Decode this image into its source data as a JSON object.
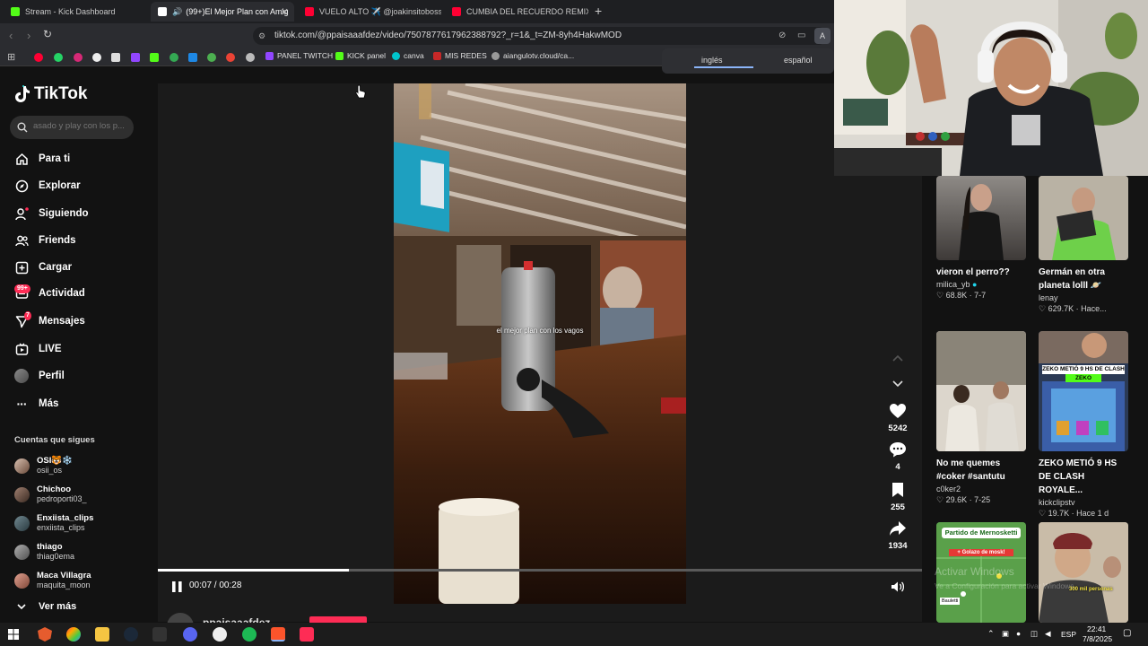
{
  "browser": {
    "tabs": [
      {
        "title": "Stream - Kick Dashboard",
        "color": "#53fc18"
      },
      {
        "title": "(99+)El Mejor Plan con Amig",
        "color": "#ffffff"
      },
      {
        "title": "VUELO ALTO ✈️ @joakinsitoboss - Y",
        "color": "#ff0033"
      },
      {
        "title": "CUMBIA DEL RECUERDO REMIXADA",
        "color": "#ff0033"
      }
    ],
    "new_tab": "+",
    "url": "tiktok.com/@ppaisaaafdez/video/7507877617962388792?_r=1&_t=ZM-8yh4HakwMOD",
    "bookmarks": [
      "PANEL TWITCH",
      "KICK panel",
      "canva",
      "MIS REDES",
      "aiangulotv.cloud/ca..."
    ],
    "translate": {
      "left": "inglés",
      "right": "español"
    }
  },
  "sidebar": {
    "logo": "TikTok",
    "search_placeholder": "asado y play con los p...",
    "nav": [
      {
        "label": "Para ti",
        "icon": "home-icon"
      },
      {
        "label": "Explorar",
        "icon": "compass-icon"
      },
      {
        "label": "Siguiendo",
        "icon": "following-icon"
      },
      {
        "label": "Friends",
        "icon": "friends-icon"
      },
      {
        "label": "Cargar",
        "icon": "upload-icon"
      },
      {
        "label": "Actividad",
        "icon": "activity-icon",
        "badge": "99+"
      },
      {
        "label": "Mensajes",
        "icon": "messages-icon",
        "badge": "7"
      },
      {
        "label": "LIVE",
        "icon": "live-icon"
      },
      {
        "label": "Perfil",
        "icon": "profile-icon"
      },
      {
        "label": "Más",
        "icon": "more-icon"
      }
    ],
    "following_title": "Cuentas que sigues",
    "accounts": [
      {
        "name": "OSI🐯❄️",
        "handle": "osii_os"
      },
      {
        "name": "Chichoo",
        "handle": "pedroporti03_"
      },
      {
        "name": "Enxiista_clips",
        "handle": "enxiista_clips"
      },
      {
        "name": "thiago",
        "handle": "thiag0ema"
      },
      {
        "name": "Maca Villagra",
        "handle": "maquita_moon"
      }
    ],
    "see_more": "Ver más"
  },
  "video": {
    "caption": "el mejor plan con los vagos",
    "time": "00:07 / 00:28",
    "progress": 0.25,
    "author": "ppaisaaafdez",
    "actions": {
      "likes": "5242",
      "comments": "4",
      "saves": "255",
      "shares": "1934"
    }
  },
  "recommended": [
    {
      "title": "vieron el perro??",
      "user": "milica_yb",
      "likes": "68.8K",
      "date": "7-7"
    },
    {
      "title": "Germán en otra planeta lolll 🪐",
      "user": "lenay",
      "likes": "629.7K",
      "date": "Hace..."
    },
    {
      "title": "No me quemes #coker #santutu",
      "user": "c0ker2",
      "likes": "29.6K",
      "date": "7-25"
    },
    {
      "title": "ZEKO METIÓ 9 HS DE CLASH ROYALE...",
      "user": "kickclipstv",
      "likes": "19.7K",
      "date": "Hace 1 d"
    },
    {
      "title": "Partido de Mernosketti",
      "user": "",
      "likes": "",
      "date": ""
    },
    {
      "title": "",
      "user": "",
      "likes": "",
      "date": ""
    }
  ],
  "thumb_texts": {
    "zeko": "ZEKO METIÓ 9 HS DE CLASH",
    "zeko2": "ZEKO",
    "partido": "Partido de Mernosketti",
    "golazo": "+ Golazo de mosk!",
    "bauletti": "Bauletti",
    "personas": "300 mil personas"
  },
  "watermark": {
    "line1": "Activar Windows",
    "line2": "Ve a Configuración para activar Windows."
  },
  "taskbar": {
    "lang": "ESP",
    "time": "22:41",
    "date": "7/8/2025"
  }
}
